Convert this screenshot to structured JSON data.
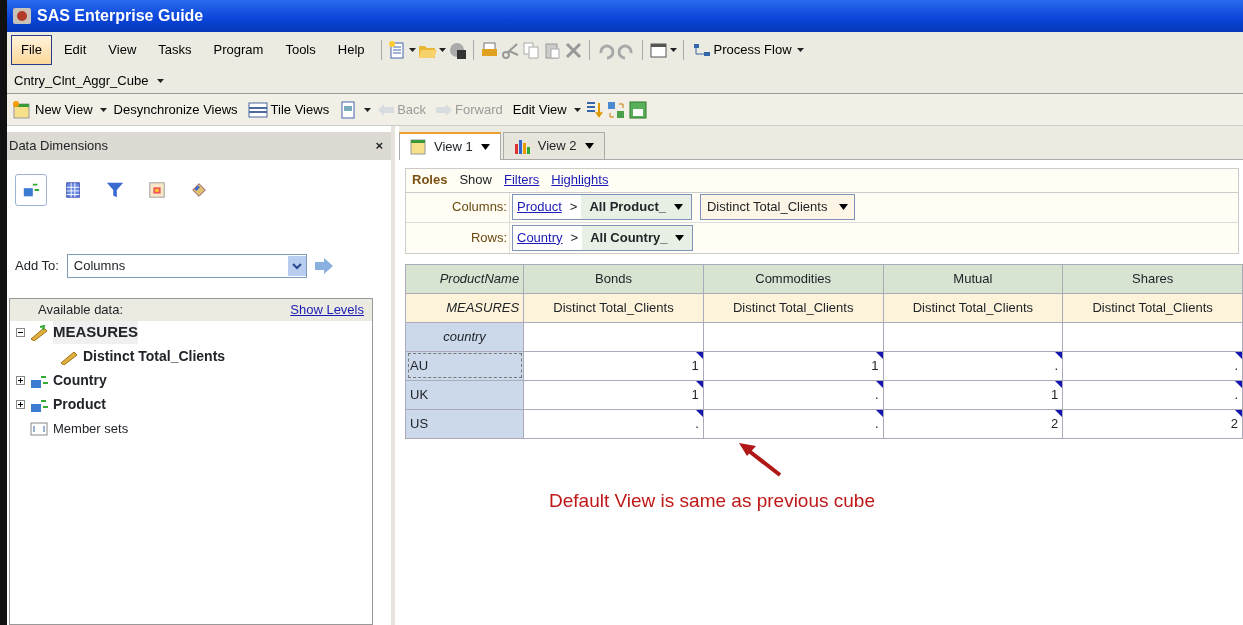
{
  "window": {
    "title": "SAS Enterprise Guide"
  },
  "menu": [
    {
      "label": "File",
      "selected": true
    },
    {
      "label": "Edit",
      "selected": false
    },
    {
      "label": "View",
      "selected": false
    },
    {
      "label": "Tasks",
      "selected": false
    },
    {
      "label": "Program",
      "selected": false
    },
    {
      "label": "Tools",
      "selected": false
    },
    {
      "label": "Help",
      "selected": false
    }
  ],
  "process_flow": {
    "label": "Process Flow"
  },
  "cube_bar": {
    "label": "Cntry_Clnt_Aggr_Cube"
  },
  "view_toolbar": [
    {
      "kind": "newview",
      "label": "New View",
      "disabled": false
    },
    {
      "kind": "plain",
      "label": "Desynchronize Views",
      "disabled": false
    },
    {
      "kind": "tile",
      "label": "Tile Views",
      "disabled": false
    },
    {
      "kind": "export",
      "disabled": false
    },
    {
      "kind": "back",
      "label": "Back",
      "disabled": true
    },
    {
      "kind": "forward",
      "label": "Forward",
      "disabled": true
    },
    {
      "kind": "menu",
      "label": "Edit View",
      "disabled": false
    }
  ],
  "panel": {
    "title": "Data Dimensions",
    "close": "×",
    "add_to_label": "Add To:",
    "add_to_value": "Columns",
    "available_label": "Available data:",
    "show_levels": "Show Levels",
    "tree": [
      {
        "label": "MEASURES",
        "kind": "measures",
        "selected": true,
        "expanded": true,
        "children": [
          {
            "label": "Distinct Total_Clients",
            "kind": "measure",
            "selected": false
          }
        ]
      },
      {
        "label": "Country",
        "kind": "dimension",
        "selected": false,
        "expanded": false
      },
      {
        "label": "Product",
        "kind": "dimension",
        "selected": false,
        "expanded": false
      },
      {
        "label": "Member sets",
        "kind": "sets",
        "selected": false
      }
    ]
  },
  "tabs": [
    {
      "label": "View 1",
      "selected": true,
      "kind": "table"
    },
    {
      "label": "View 2",
      "selected": false,
      "kind": "chart"
    }
  ],
  "roles": {
    "title": "Roles",
    "show": "Show",
    "links": [
      "Filters",
      "Highlights"
    ],
    "columns": {
      "label": "Columns:",
      "dimension": "Product",
      "separator": ">",
      "level": "All Product_",
      "measure": "Distinct Total_Clients"
    },
    "rows": {
      "label": "Rows:",
      "dimension": "Country",
      "separator": ">",
      "level": "All Country_"
    }
  },
  "table": {
    "corner": "ProductName",
    "columns": [
      "Bonds",
      "Commodities",
      "Mutual",
      "Shares"
    ],
    "measures_label": "MEASURES",
    "measures": [
      "Distinct Total_Clients",
      "Distinct Total_Clients",
      "Distinct Total_Clients",
      "Distinct Total_Clients"
    ],
    "row_header": "country",
    "rows": [
      {
        "label": "AU",
        "selected": true,
        "values": [
          "1",
          "1",
          ".",
          "."
        ]
      },
      {
        "label": "UK",
        "selected": false,
        "values": [
          "1",
          ".",
          "1",
          "."
        ]
      },
      {
        "label": "US",
        "selected": false,
        "values": [
          ".",
          ".",
          "2",
          "2"
        ]
      }
    ]
  },
  "annotation": {
    "text": "Default View is same as previous cube"
  }
}
